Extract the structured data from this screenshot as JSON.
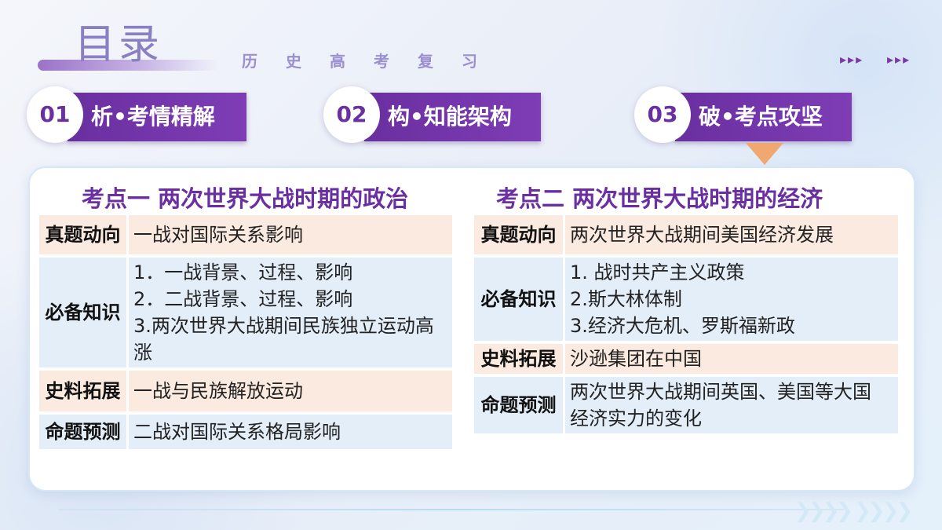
{
  "header": {
    "title": "目录",
    "subtitle": "历史高考复习",
    "arrows_left": "▸▸▸",
    "arrows_right": "▸▸▸"
  },
  "tabs": [
    {
      "num": "01",
      "label": "析•考情精解"
    },
    {
      "num": "02",
      "label": "构•知能架构"
    },
    {
      "num": "03",
      "label": "破•考点攻坚"
    }
  ],
  "left": {
    "title": "考点一 两次世界大战时期的政治",
    "rows": [
      {
        "key": "真题动向",
        "lines": [
          "一战对国际关系影响"
        ]
      },
      {
        "key": "必备知识",
        "lines": [
          "1．一战背景、过程、影响",
          "2．二战背景、过程、影响",
          "3.两次世界大战期间民族独立运动高",
          "涨"
        ]
      },
      {
        "key": "史料拓展",
        "lines": [
          "一战与民族解放运动"
        ]
      },
      {
        "key": "命题预测",
        "lines": [
          "二战对国际关系格局影响"
        ]
      }
    ]
  },
  "right": {
    "title": "考点二  两次世界大战时期的经济",
    "rows": [
      {
        "key": "真题动向",
        "lines": [
          "两次世界大战期间美国经济发展"
        ]
      },
      {
        "key": "必备知识",
        "lines": [
          "1. 战时共产主义政策",
          "2.斯大林体制",
          "3.经济大危机、罗斯福新政"
        ]
      },
      {
        "key": "史料拓展",
        "lines": [
          "沙逊集团在中国"
        ]
      },
      {
        "key": "命题预测",
        "lines": [
          "两次世界大战期间英国、美国等大国",
          "经济实力的变化"
        ]
      }
    ]
  },
  "footer": {
    "chevrons_a": "❯❯❯❯",
    "chevrons_b": "❯❯❯❯"
  }
}
